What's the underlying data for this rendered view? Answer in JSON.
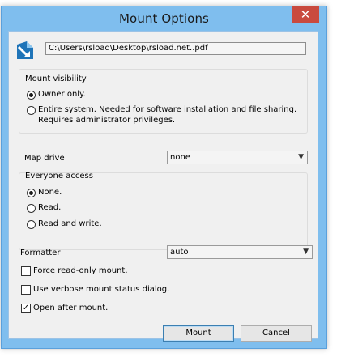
{
  "window": {
    "title": "Mount Options",
    "close_glyph": "✕"
  },
  "source_path": "C:\\Users\\rsload\\Desktop\\rsload.net..pdf",
  "mount_visibility": {
    "title": "Mount visibility",
    "owner_only": "Owner only.",
    "entire_system_line1": "Entire system. Needed for software installation and file sharing.",
    "entire_system_line2": "Requires administrator privileges.",
    "selected": "owner_only"
  },
  "map_drive": {
    "label": "Map drive",
    "value": "none"
  },
  "everyone_access": {
    "title": "Everyone access",
    "none": "None.",
    "read": "Read.",
    "read_write": "Read and write.",
    "selected": "none"
  },
  "formatter": {
    "label": "Formatter",
    "value": "auto"
  },
  "options": {
    "read_only": {
      "label": "Force read-only mount.",
      "checked": false
    },
    "verbose": {
      "label": "Use verbose mount status dialog.",
      "checked": false
    },
    "open_after": {
      "label": "Open after mount.",
      "checked": true
    }
  },
  "buttons": {
    "mount": "Mount",
    "cancel": "Cancel"
  },
  "icons": {
    "file": "file-mount-icon",
    "close": "close-icon",
    "dropdown": "chevron-down-icon"
  },
  "colors": {
    "title_bar": "#7fbeee",
    "close_button": "#c94a3e",
    "client": "#f0f0f0"
  }
}
